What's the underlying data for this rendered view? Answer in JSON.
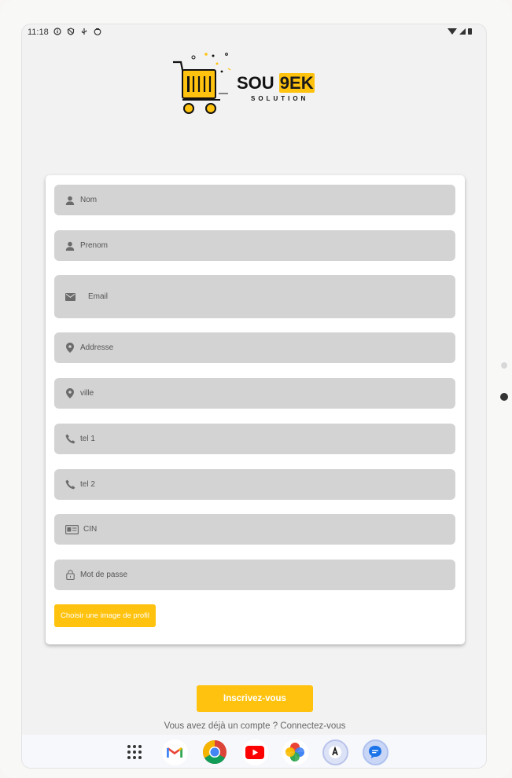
{
  "status_bar": {
    "time": "11:18"
  },
  "logo": {
    "main": "SOU ",
    "accent": "9EK",
    "sub": "SOLUTION"
  },
  "form": {
    "fields": [
      {
        "icon": "person-icon",
        "placeholder": "Nom"
      },
      {
        "icon": "person-icon",
        "placeholder": "Prenom"
      },
      {
        "icon": "email-icon",
        "placeholder": "Email"
      },
      {
        "icon": "location-icon",
        "placeholder": "Addresse"
      },
      {
        "icon": "location-icon",
        "placeholder": "ville"
      },
      {
        "icon": "phone-icon",
        "placeholder": "tel 1"
      },
      {
        "icon": "phone-icon",
        "placeholder": "tel 2"
      },
      {
        "icon": "id-card-icon",
        "placeholder": "CIN"
      },
      {
        "icon": "lock-icon",
        "placeholder": "Mot de passe"
      }
    ],
    "photo_button": "Choisir une image de profil"
  },
  "submit_button": "Inscrivez-vous",
  "login_prompt": "Vous avez déjà un compte ? Connectez-vous",
  "dock": {
    "apps": [
      "app-drawer-icon",
      "gmail-icon",
      "chrome-icon",
      "youtube-icon",
      "photos-icon",
      "app-icon",
      "messages-icon"
    ]
  },
  "colors": {
    "accent": "#ffc20e",
    "field_bg": "#d3d3d3",
    "card_bg": "#ffffff",
    "screen_bg": "#f2f2f2"
  }
}
